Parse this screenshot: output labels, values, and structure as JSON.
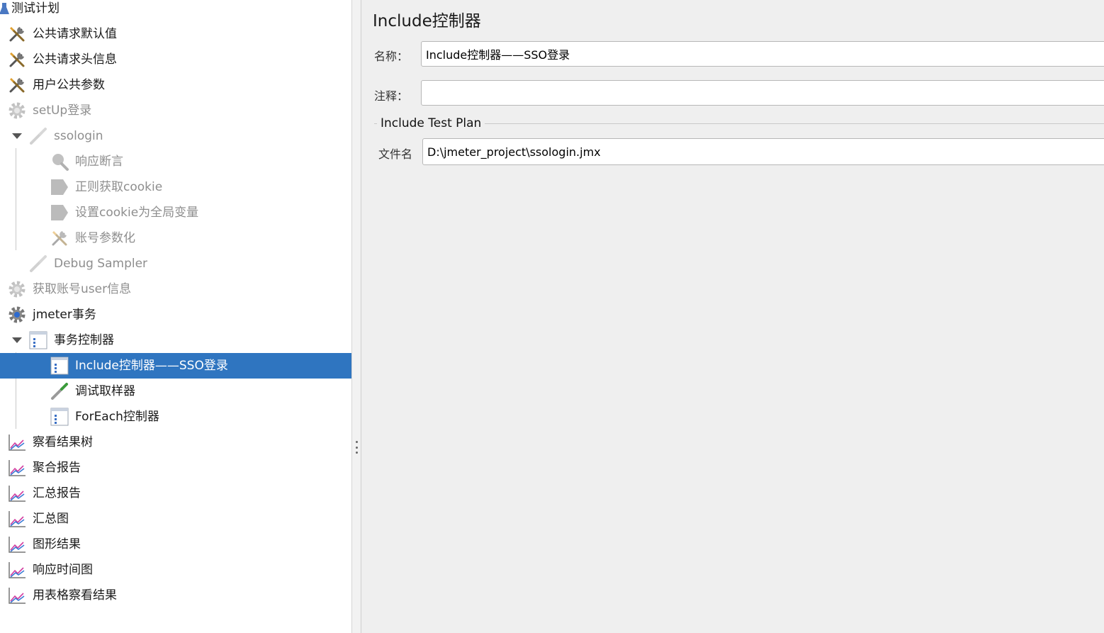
{
  "tree": {
    "items": [
      {
        "label": "测试计划",
        "icon": "flask-icon",
        "level": 0,
        "disabled": false,
        "selected": false
      },
      {
        "label": "公共请求默认值",
        "icon": "tools-icon",
        "level": 0,
        "disabled": false,
        "selected": false
      },
      {
        "label": "公共请求头信息",
        "icon": "tools-icon",
        "level": 0,
        "disabled": false,
        "selected": false
      },
      {
        "label": "用户公共参数",
        "icon": "tools-icon",
        "level": 0,
        "disabled": false,
        "selected": false
      },
      {
        "label": "setUp登录",
        "icon": "gear-icon",
        "level": 0,
        "disabled": true,
        "selected": false
      },
      {
        "label": "ssologin",
        "icon": "pipette-icon",
        "level": 1,
        "disabled": true,
        "selected": false,
        "expanded": true
      },
      {
        "label": "响应断言",
        "icon": "magnifier-icon",
        "level": 2,
        "disabled": true,
        "selected": false
      },
      {
        "label": "正则获取cookie",
        "icon": "extractor-icon",
        "level": 2,
        "disabled": true,
        "selected": false
      },
      {
        "label": "设置cookie为全局变量",
        "icon": "extractor-icon",
        "level": 2,
        "disabled": true,
        "selected": false
      },
      {
        "label": "账号参数化",
        "icon": "tools-icon",
        "level": 2,
        "disabled": true,
        "selected": false
      },
      {
        "label": "Debug Sampler",
        "icon": "pipette-icon",
        "level": 1,
        "disabled": true,
        "selected": false
      },
      {
        "label": "获取账号user信息",
        "icon": "gear-icon",
        "level": 0,
        "disabled": true,
        "selected": false
      },
      {
        "label": "jmeter事务",
        "icon": "gear-icon",
        "level": 0,
        "disabled": false,
        "selected": false
      },
      {
        "label": "事务控制器",
        "icon": "controller-icon",
        "level": 1,
        "disabled": false,
        "selected": false,
        "expanded": true
      },
      {
        "label": "Include控制器——SSO登录",
        "icon": "controller-icon",
        "level": 2,
        "disabled": false,
        "selected": true
      },
      {
        "label": "调试取样器",
        "icon": "pipette-icon",
        "level": 2,
        "disabled": false,
        "selected": false
      },
      {
        "label": "ForEach控制器",
        "icon": "controller-icon",
        "level": 2,
        "disabled": false,
        "selected": false
      },
      {
        "label": "察看结果树",
        "icon": "graph-icon",
        "level": 0,
        "disabled": false,
        "selected": false
      },
      {
        "label": "聚合报告",
        "icon": "graph-icon",
        "level": 0,
        "disabled": false,
        "selected": false
      },
      {
        "label": "汇总报告",
        "icon": "graph-icon",
        "level": 0,
        "disabled": false,
        "selected": false
      },
      {
        "label": "汇总图",
        "icon": "graph-icon",
        "level": 0,
        "disabled": false,
        "selected": false
      },
      {
        "label": "图形结果",
        "icon": "graph-icon",
        "level": 0,
        "disabled": false,
        "selected": false
      },
      {
        "label": "响应时间图",
        "icon": "graph-icon",
        "level": 0,
        "disabled": false,
        "selected": false
      },
      {
        "label": "用表格察看结果",
        "icon": "graph-icon",
        "level": 0,
        "disabled": false,
        "selected": false
      }
    ]
  },
  "detail": {
    "title": "Include控制器",
    "name_label": "名称：",
    "name_value": "Include控制器——SSO登录",
    "comment_label": "注释：",
    "comment_value": "",
    "group_title": "Include Test Plan",
    "file_label": "文件名",
    "file_value": "D:\\jmeter_project\\ssologin.jmx"
  },
  "colors": {
    "selection": "#2f75c0",
    "panel_background": "#efefef",
    "disabled_text": "#8e8e8e"
  }
}
